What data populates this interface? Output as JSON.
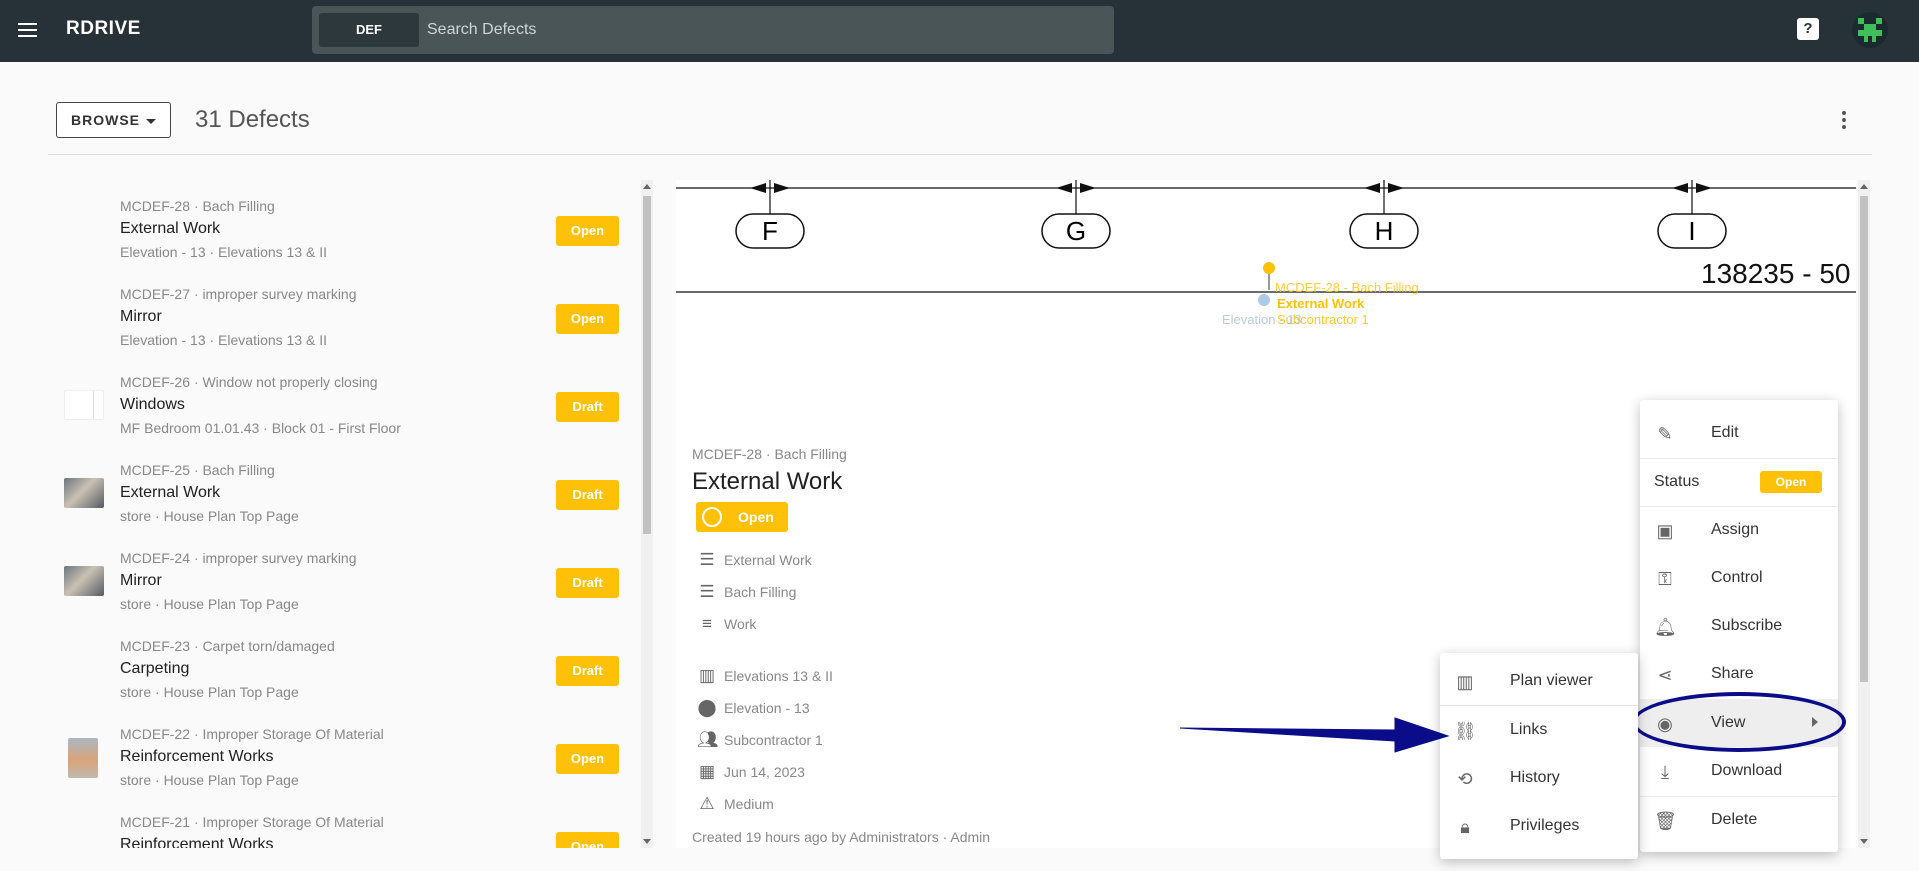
{
  "app": {
    "brand": "RDRIVE",
    "search_chip": "DEF",
    "search_placeholder": "Search Defects"
  },
  "toolbar": {
    "browse_label": "BROWSE",
    "count_label": "31 Defects"
  },
  "defects": [
    {
      "sub": "MCDEF-28 · Bach Filling",
      "title": "External Work",
      "loc": "Elevation - 13 · Elevations 13 & II",
      "status": "Open",
      "thumb": "none"
    },
    {
      "sub": "MCDEF-27 · improper survey marking",
      "title": "Mirror",
      "loc": "Elevation - 13 · Elevations 13 & II",
      "status": "Open",
      "thumb": "none"
    },
    {
      "sub": "MCDEF-26 · Window not properly closing",
      "title": "Windows",
      "loc": "MF Bedroom 01.01.43 · Block 01 - First Floor",
      "status": "Draft",
      "thumb": "document"
    },
    {
      "sub": "MCDEF-25 · Bach Filling",
      "title": "External Work",
      "loc": "store · House Plan Top Page",
      "status": "Draft",
      "thumb": "photo"
    },
    {
      "sub": "MCDEF-24 · improper survey marking",
      "title": "Mirror",
      "loc": "store · House Plan Top Page",
      "status": "Draft",
      "thumb": "photo"
    },
    {
      "sub": "MCDEF-23 · Carpet torn/damaged",
      "title": "Carpeting",
      "loc": "store · House Plan Top Page",
      "status": "Draft",
      "thumb": "none"
    },
    {
      "sub": "MCDEF-22 · Improper Storage Of Material",
      "title": "Reinforcement Works",
      "loc": "store · House Plan Top Page",
      "status": "Open",
      "thumb": "photo"
    },
    {
      "sub": "MCDEF-21 · Improper Storage Of Material",
      "title": "Reinforcement Works",
      "loc": "",
      "status": "Open",
      "thumb": "none"
    }
  ],
  "plan": {
    "grid_labels": [
      "F",
      "G",
      "H",
      "I"
    ],
    "dimension_text": "138235 - 50",
    "pin_line1": "MCDEF-28 - Bach Filling",
    "pin_line2": "External Work",
    "pin_line3": "Subcontractor 1",
    "pin_location": "Elevation - 13"
  },
  "detail": {
    "sub": "MCDEF-28 · Bach Filling",
    "title": "External Work",
    "status": "Open",
    "rows": [
      {
        "icon": "list-icon",
        "text": "External Work"
      },
      {
        "icon": "list-icon",
        "text": "Bach Filling"
      },
      {
        "icon": "text-icon",
        "text": "Work"
      },
      {
        "icon": "map-icon",
        "text": "Elevations 13 & II"
      },
      {
        "icon": "location-pin-icon",
        "text": "Elevation - 13"
      },
      {
        "icon": "people-icon",
        "text": "Subcontractor 1"
      },
      {
        "icon": "calendar-icon",
        "text": "Jun 14, 2023"
      },
      {
        "icon": "warning-icon",
        "text": "Medium"
      }
    ],
    "created": "Created 19 hours ago by Administrators · Admin"
  },
  "context_menu": {
    "edit": "Edit",
    "status_label": "Status",
    "status_value": "Open",
    "assign": "Assign",
    "control": "Control",
    "subscribe": "Subscribe",
    "share": "Share",
    "view": "View",
    "download": "Download",
    "delete": "Delete"
  },
  "view_submenu": {
    "plan_viewer": "Plan viewer",
    "links": "Links",
    "history": "History",
    "privileges": "Privileges"
  },
  "colors": {
    "header": "#263238",
    "accent": "#ffc107",
    "annotation": "#0a0c8a"
  }
}
